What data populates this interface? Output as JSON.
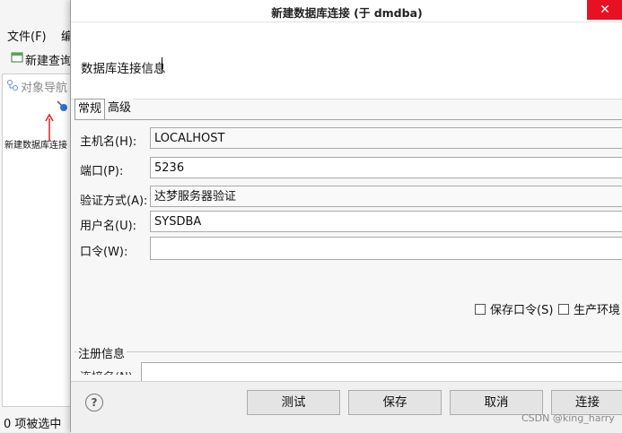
{
  "background_app": {
    "menu": {
      "file": "文件(F)",
      "edit_partial": "编"
    },
    "toolbar": {
      "new_query": "新建查询"
    },
    "nav_panel": {
      "title": "对象导航",
      "hint": "新建数据库连接"
    },
    "status": "0 项被选中"
  },
  "dialog": {
    "title": "新建数据库连接 (于 dmdba)",
    "close_glyph": "✕",
    "banner": "数据库连接信息",
    "tabs": [
      "常规",
      "高级"
    ],
    "form": {
      "host_label": "主机名(H):",
      "host_value": "LOCALHOST",
      "port_label": "端口(P):",
      "port_value": "5236",
      "auth_label": "验证方式(A):",
      "auth_value": "达梦服务器验证",
      "user_label": "用户名(U):",
      "user_value": "SYSDBA",
      "password_label": "口令(W):",
      "password_value": ""
    },
    "checkboxes": {
      "save_password": "保存口令(S)",
      "production_env": "生产环境"
    },
    "register": {
      "legend": "注册信息",
      "name_label_partial": "连接名(N):"
    },
    "buttons": {
      "help": "?",
      "test": "测试",
      "save": "保存",
      "cancel": "取消",
      "connect": "连接"
    }
  },
  "watermark": "CSDN @king_harry",
  "colors": {
    "close_red": "#e81123",
    "arrow_red": "#d9241c",
    "accent_blue": "#2f6fd0"
  }
}
